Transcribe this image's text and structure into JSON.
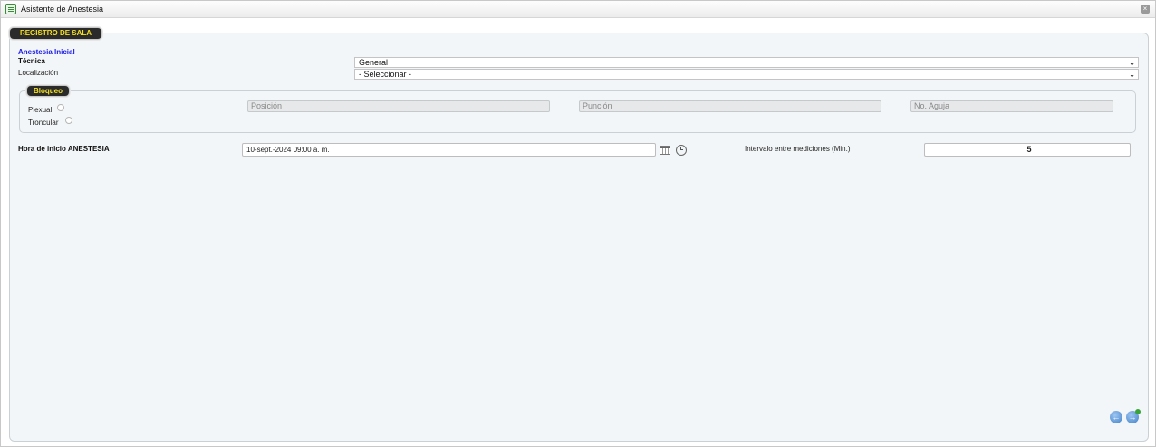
{
  "window": {
    "title": "Asistente de Anestesia",
    "close_symbol": "×"
  },
  "section": {
    "legend": "REGISTRO DE SALA"
  },
  "anestesia": {
    "heading": "Anestesia Inicial",
    "tecnica_label": "Técnica",
    "tecnica_value": "General",
    "localizacion_label": "Localización",
    "localizacion_value": "- Seleccionar -"
  },
  "bloqueo": {
    "legend": "Bloqueo",
    "plexual_label": "Plexual",
    "troncular_label": "Troncular",
    "posicion_placeholder": "Posición",
    "puncion_placeholder": "Punción",
    "aguja_placeholder": "No. Aguja"
  },
  "hora": {
    "label": "Hora de inicio ANESTESIA",
    "value": "10-sept.-2024 09:00 a. m."
  },
  "intervalo": {
    "label": "Intervalo entre mediciones (Min.)",
    "value": "5"
  },
  "icons": {
    "chevron": "⌄",
    "prev": "←",
    "next": "→"
  },
  "colors": {
    "legend_bg": "#2b2b2b",
    "legend_text": "#f5e11f",
    "heading_blue": "#1a1ae6",
    "nav_blue": "#3f7fc8"
  }
}
